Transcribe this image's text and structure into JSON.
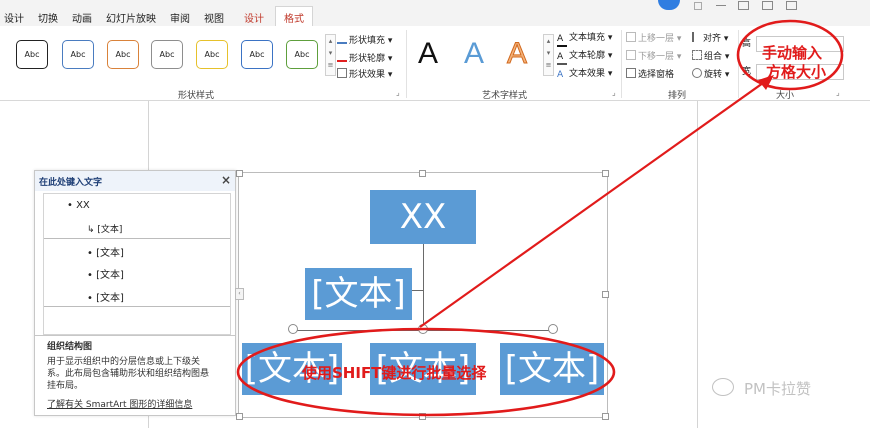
{
  "tabs": [
    "设计",
    "切换",
    "动画",
    "幻灯片放映",
    "审阅",
    "视图",
    "设计",
    "格式"
  ],
  "ribbon": {
    "shape_styles": {
      "label": "形状样式",
      "swatch_text": "Abc",
      "swatch_colors": [
        "#222222",
        "#4a7cc0",
        "#d9823a",
        "#8e8e8e",
        "#e6c12b",
        "#3b73c4",
        "#5e9f3c"
      ],
      "fill": "形状填充",
      "outline": "形状轮廓",
      "effect": "形状效果"
    },
    "wordart": {
      "label": "艺术字样式",
      "letter": "A",
      "text_fill": "文本填充",
      "text_outline": "文本轮廓",
      "text_effect": "文本效果"
    },
    "arrange": {
      "label": "排列",
      "bring_forward": "上移一层",
      "send_backward": "下移一层",
      "selection_pane": "选择窗格",
      "align": "对齐",
      "group": "组合",
      "rotate": "旋转"
    },
    "size": {
      "label": "大小",
      "height_prefix": "高",
      "width_prefix": "宽"
    }
  },
  "text_pane": {
    "title": "在此处键入文字",
    "close": "×",
    "items": [
      "XX",
      "[文本]",
      "[文本]",
      "[文本]",
      "[文本]"
    ],
    "info_title": "组织结构图",
    "info_desc_1": "用于显示组织中的分层信息或上下级关",
    "info_desc_2": "系。此布局包含辅助形状和组织结构图悬",
    "info_desc_3": "挂布局。",
    "link": "了解有关 SmartArt 图形的详细信息"
  },
  "smartart": {
    "top": "XX",
    "assistant": "[文本]",
    "children": [
      "[文本]",
      "[文本]",
      "[文本]"
    ]
  },
  "annotations": {
    "size_note_1": "手动输入",
    "size_note_2": "方格大小",
    "shift_note": "使用SHIFT键进行批量选择",
    "red": "#e11b1b"
  },
  "watermark": "PM卡拉赞"
}
